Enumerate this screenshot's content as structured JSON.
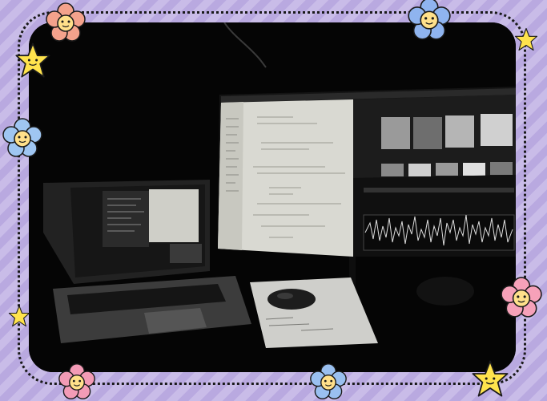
{
  "scene": {
    "subject": "desk-setup",
    "devices": [
      "laptop",
      "external-monitor",
      "mouse",
      "notepad"
    ],
    "palette": {
      "frame_bg_light": "#c9bce8",
      "frame_bg_dark": "#b9a9e0",
      "photo_bg": "#050505",
      "screen_light": "#d9d9d2",
      "screen_dark": "#1c1c1c",
      "waveform": "#dcdcdc"
    }
  },
  "stickers": [
    {
      "kind": "flower",
      "color": "#f4a28c",
      "center": "#ffe08a"
    },
    {
      "kind": "flower",
      "color": "#8fb4ef",
      "center": "#ffe08a"
    },
    {
      "kind": "flower",
      "color": "#9fc6f2",
      "center": "#ffe08a"
    },
    {
      "kind": "flower",
      "color": "#f6a1b9",
      "center": "#ffe08a"
    },
    {
      "kind": "flower",
      "color": "#f39bb6",
      "center": "#ffe08a"
    },
    {
      "kind": "flower",
      "color": "#9ac0f0",
      "center": "#ffe08a"
    },
    {
      "kind": "star",
      "color": "#ffe34d"
    },
    {
      "kind": "star",
      "color": "#ffe34d"
    },
    {
      "kind": "star",
      "color": "#ffe34d"
    },
    {
      "kind": "star",
      "color": "#ffe34d"
    }
  ]
}
